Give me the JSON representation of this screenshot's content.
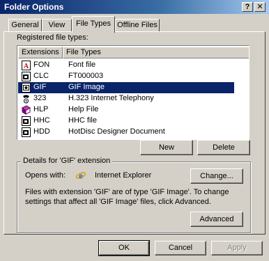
{
  "window": {
    "title": "Folder Options",
    "help_button": "?",
    "close_button": "X"
  },
  "tabs": [
    {
      "label": "General"
    },
    {
      "label": "View"
    },
    {
      "label": "File Types"
    },
    {
      "label": "Offline Files"
    }
  ],
  "registered_label": "Registered file types:",
  "list": {
    "headers": {
      "extensions": "Extensions",
      "file_types": "File Types"
    },
    "rows": [
      {
        "ext": "FON",
        "type": "Font file",
        "icon": "font-file-icon"
      },
      {
        "ext": "CLC",
        "type": "FT000003",
        "icon": "generic-app-icon"
      },
      {
        "ext": "GIF",
        "type": "GIF Image",
        "icon": "image-file-icon",
        "selected": true
      },
      {
        "ext": "323",
        "type": "H.323 Internet Telephony",
        "icon": "telephony-icon"
      },
      {
        "ext": "HLP",
        "type": "Help File",
        "icon": "help-book-icon"
      },
      {
        "ext": "HHC",
        "type": "HHC file",
        "icon": "generic-app-icon"
      },
      {
        "ext": "HDD",
        "type": "HotDisc Designer Document",
        "icon": "generic-app-icon"
      }
    ]
  },
  "buttons": {
    "new": "New",
    "delete": "Delete",
    "change": "Change...",
    "advanced": "Advanced",
    "ok": "OK",
    "cancel": "Cancel",
    "apply": "Apply"
  },
  "details": {
    "title": "Details for 'GIF' extension",
    "opens_with_label": "Opens with:",
    "opens_with_app": "Internet Explorer",
    "description_line1": "Files with extension 'GIF' are of type 'GIF Image'.  To change",
    "description_line2": "settings that affect all 'GIF Image' files, click Advanced."
  },
  "colors": {
    "title_bar": "#0a246a",
    "face": "#d4d0c8",
    "selection": "#0a246a"
  }
}
